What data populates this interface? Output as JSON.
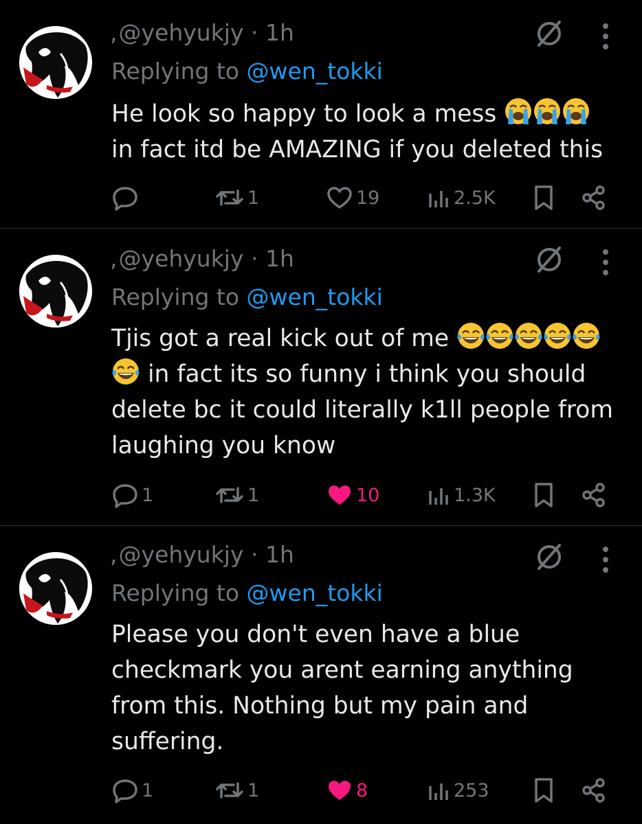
{
  "colors": {
    "background": "#000000",
    "text": "#e7e9ea",
    "muted": "#71767b",
    "link": "#1d9bf0",
    "like": "#f91880",
    "divider": "#2f3336"
  },
  "icons": [
    "avatar",
    "muted-conversation-icon",
    "more-icon",
    "reply-icon",
    "retweet-icon",
    "heart-icon",
    "views-icon",
    "bookmark-icon",
    "share-icon",
    "loudly-crying-face-emoji",
    "tears-of-joy-emoji"
  ],
  "tweets": [
    {
      "comma": ",",
      "handle": "@yehyukjy",
      "time": "· 1h",
      "replying_prefix": "Replying to ",
      "replying_handle": "@wen_tokki",
      "lines": [
        "He look so happy to look a mess",
        "in fact itd be AMAZING if you deleted this"
      ],
      "emojis": [
        "loudly-crying-face",
        "loudly-crying-face",
        "loudly-crying-face"
      ],
      "replies": "",
      "retweets": "1",
      "likes": "19",
      "liked": false,
      "views": "2.5K"
    },
    {
      "comma": ",",
      "handle": "@yehyukjy",
      "time": "· 1h",
      "replying_prefix": "Replying to ",
      "replying_handle": "@wen_tokki",
      "lines": [
        "Tjis got a real kick out of me",
        "in fact its so funny i think you should",
        "delete bc it could literally k1ll people from",
        "laughing you know"
      ],
      "emojis": [
        "tears-of-joy",
        "tears-of-joy",
        "tears-of-joy",
        "tears-of-joy",
        "tears-of-joy",
        "tears-of-joy"
      ],
      "replies": "1",
      "retweets": "1",
      "likes": "10",
      "liked": true,
      "views": "1.3K"
    },
    {
      "comma": ",",
      "handle": "@yehyukjy",
      "time": "· 1h",
      "replying_prefix": "Replying to ",
      "replying_handle": "@wen_tokki",
      "lines": [
        "Please you don't even have a blue",
        "checkmark you arent earning anything",
        "from this. Nothing but my pain and",
        "suffering."
      ],
      "emojis": [],
      "replies": "1",
      "retweets": "1",
      "likes": "8",
      "liked": true,
      "views": "253"
    }
  ]
}
